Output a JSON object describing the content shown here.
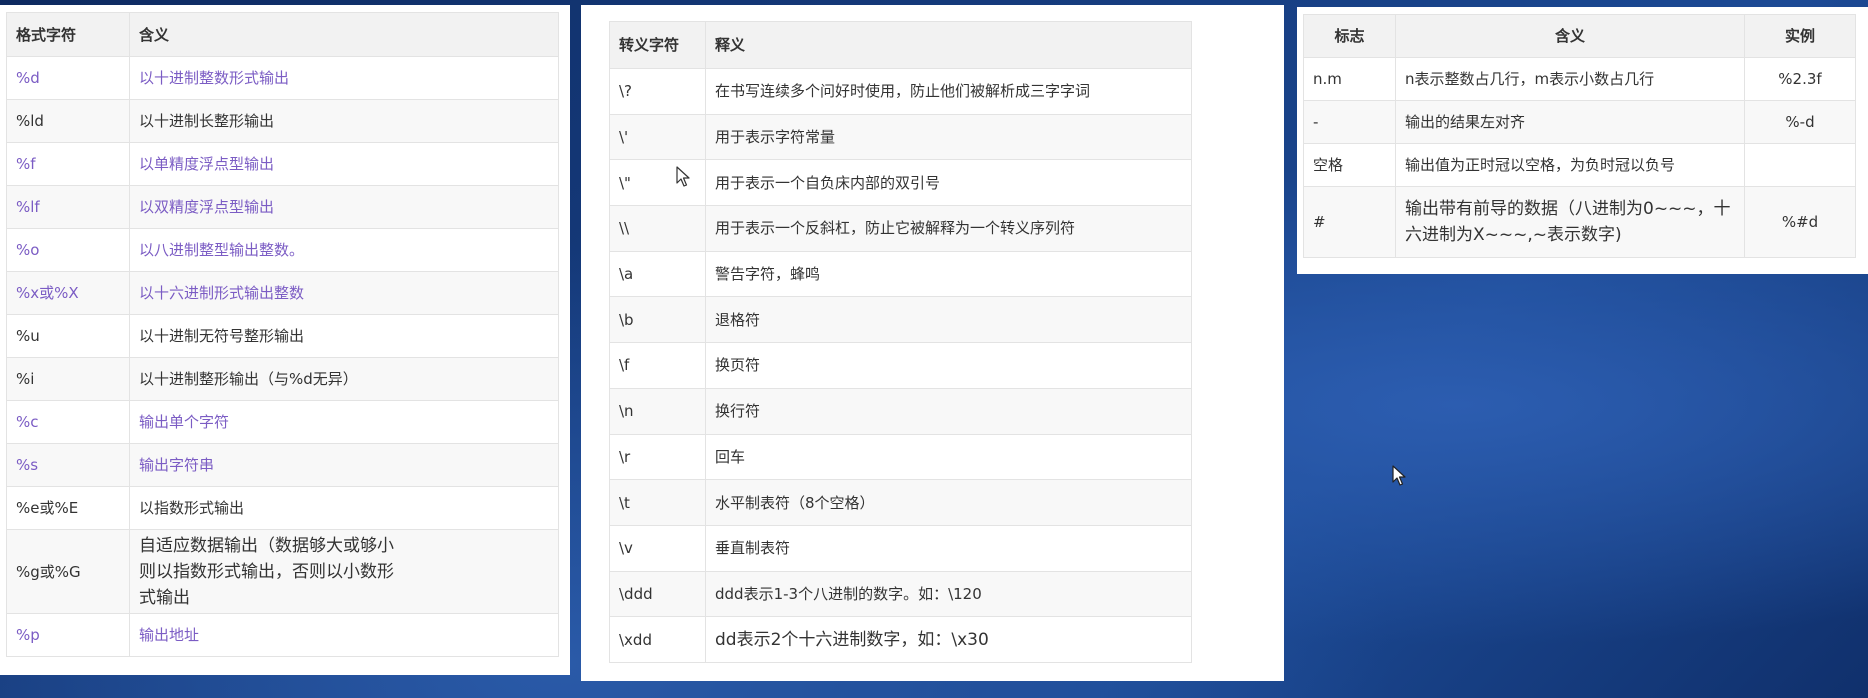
{
  "format_table": {
    "headers": [
      "格式字符",
      "含义"
    ],
    "rows": [
      {
        "code": "%d",
        "meaning": "以十进制整数形式输出"
      },
      {
        "code": "%ld",
        "meaning": "以十进制长整形输出"
      },
      {
        "code": "%f",
        "meaning": "以单精度浮点型输出"
      },
      {
        "code": "%lf",
        "meaning": "以双精度浮点型输出"
      },
      {
        "code": "%o",
        "meaning": "以八进制整型输出整数。"
      },
      {
        "code": "%x或%X",
        "meaning": "以十六进制形式输出整数"
      },
      {
        "code": "%u",
        "meaning": "以十进制无符号整形输出"
      },
      {
        "code": "%i",
        "meaning": "以十进制整形输出（与%d无异）"
      },
      {
        "code": "%c",
        "meaning": "输出单个字符"
      },
      {
        "code": "%s",
        "meaning": "输出字符串"
      },
      {
        "code": "%e或%E",
        "meaning": "以指数形式输出"
      },
      {
        "code": "%g或%G",
        "meaning": "自适应数据输出（数据够大或够小则以指数形式输出，否则以小数形式输出"
      },
      {
        "code": "%p",
        "meaning": "输出地址"
      }
    ]
  },
  "escape_table": {
    "headers": [
      "转义字符",
      "释义"
    ],
    "rows": [
      {
        "code": "\\?",
        "meaning": "在书写连续多个问好时使用，防止他们被解析成三字字词"
      },
      {
        "code": "\\'",
        "meaning": "用于表示字符常量"
      },
      {
        "code": "\\\"",
        "meaning": "用于表示一个自负床内部的双引号"
      },
      {
        "code": "\\\\",
        "meaning": "用于表示一个反斜杠，防止它被解释为一个转义序列符"
      },
      {
        "code": "\\a",
        "meaning": "警告字符，蜂鸣"
      },
      {
        "code": "\\b",
        "meaning": "退格符"
      },
      {
        "code": "\\f",
        "meaning": "换页符"
      },
      {
        "code": "\\n",
        "meaning": "换行符"
      },
      {
        "code": "\\r",
        "meaning": "回车"
      },
      {
        "code": "\\t",
        "meaning": "水平制表符（8个空格）"
      },
      {
        "code": "\\v",
        "meaning": "垂直制表符"
      },
      {
        "code": "\\ddd",
        "meaning": "ddd表示1-3个八进制的数字。如：\\120"
      },
      {
        "code": "\\xdd",
        "meaning": "dd表示2个十六进制数字，如：\\x30"
      }
    ]
  },
  "flags_table": {
    "headers": [
      "标志",
      "含义",
      "实例"
    ],
    "rows": [
      {
        "flag": "n.m",
        "meaning": "n表示整数占几行，m表示小数占几行",
        "example": "%2.3f"
      },
      {
        "flag": "-",
        "meaning": "输出的结果左对齐",
        "example": "%-d"
      },
      {
        "flag": "空格",
        "meaning": "输出值为正时冠以空格，为负时冠以负号",
        "example": ""
      },
      {
        "flag": "#",
        "meaning": "输出带有前导的数据（八进制为0~~~，十六进制为X~~~,~表示数字)",
        "example": "%#d"
      }
    ]
  },
  "colors": {
    "link": "#7b5cc4",
    "header_bg": "#f2f2f2",
    "border": "#e3e3e3",
    "desktop_bg": "#163d80"
  },
  "icons": [
    "mouse-cursor-icon"
  ]
}
